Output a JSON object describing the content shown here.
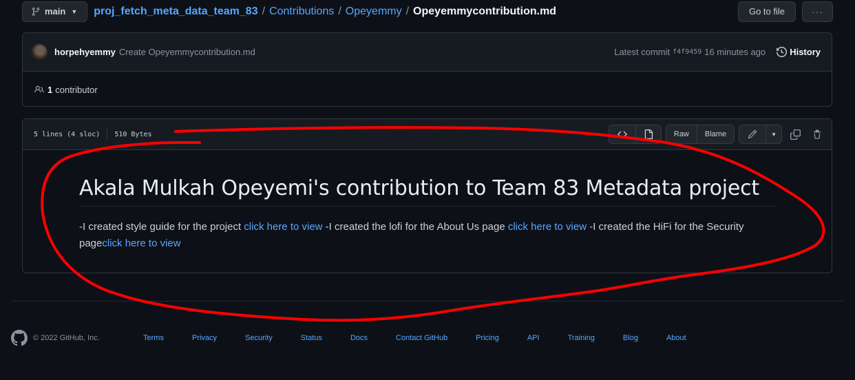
{
  "topbar": {
    "branch": "main",
    "breadcrumb": {
      "repo": "proj_fetch_meta_data_team_83",
      "folder": "Contributions",
      "subfolder": "Opeyemmy",
      "file": "Opeyemmycontribution.md",
      "separator": "/"
    },
    "go_to_file": "Go to file",
    "more": "···"
  },
  "commit": {
    "author": "horpehyemmy",
    "message": "Create Opeyemmycontribution.md",
    "latest_label": "Latest commit",
    "sha": "f4f9459",
    "time": "16 minutes ago",
    "history": "History"
  },
  "contributors": {
    "count": "1",
    "label": "contributor"
  },
  "file": {
    "lines": "5 lines (4 sloc)",
    "size": "510 Bytes",
    "raw": "Raw",
    "blame": "Blame"
  },
  "markdown": {
    "title": "Akala Mulkah Opeyemi's contribution to Team 83 Metadata project",
    "text1": "-I created style guide for the project ",
    "link1": "click here to view",
    "text2": " -I created the lofi for the About Us page ",
    "link2": "click here to view",
    "text3": " -I created the HiFi for the Security page",
    "link3": "click here to view"
  },
  "footer": {
    "copyright": "© 2022 GitHub, Inc.",
    "links": [
      "Terms",
      "Privacy",
      "Security",
      "Status",
      "Docs",
      "Contact GitHub",
      "Pricing",
      "API",
      "Training",
      "Blog",
      "About"
    ]
  },
  "colors": {
    "background": "#0d1117",
    "link": "#58a6ff",
    "annotation": "#ff0000"
  }
}
